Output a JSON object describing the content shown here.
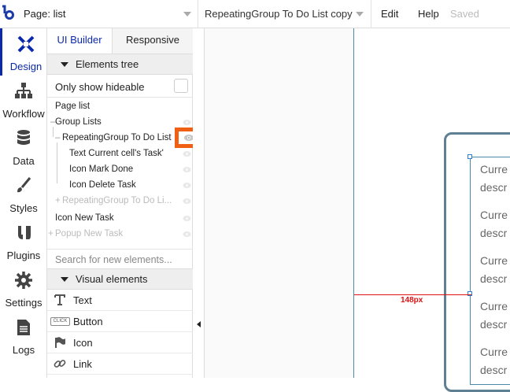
{
  "topbar": {
    "page_label": "Page: list",
    "element_select": "RepeatingGroup To Do List copy",
    "menu_edit": "Edit",
    "menu_help": "Help",
    "status": "Saved"
  },
  "leftnav": {
    "items": [
      {
        "label": "Design",
        "icon": "design-icon"
      },
      {
        "label": "Workflow",
        "icon": "workflow-icon"
      },
      {
        "label": "Data",
        "icon": "database-icon"
      },
      {
        "label": "Styles",
        "icon": "brush-icon"
      },
      {
        "label": "Plugins",
        "icon": "plug-icon"
      },
      {
        "label": "Settings",
        "icon": "gear-icon"
      },
      {
        "label": "Logs",
        "icon": "document-icon"
      }
    ]
  },
  "panel": {
    "tabs": [
      "UI Builder",
      "Responsive"
    ],
    "elements_tree_title": "Elements tree",
    "only_show_hideable": "Only show hideable",
    "tree": [
      "Page list",
      "Group Lists",
      "RepeatingGroup To Do List",
      "Text Current cell's Task'",
      "Icon Mark Done",
      "Icon Delete Task",
      "RepeatingGroup To Do Li...",
      "Icon New Task",
      "Popup New Task"
    ],
    "search_placeholder": "Search for new elements...",
    "visual_elements_title": "Visual elements",
    "visual_elements": [
      "Text",
      "Button",
      "Icon",
      "Link"
    ],
    "button_icon_text": "CLICK"
  },
  "canvas": {
    "measure_label": "148px",
    "cells": [
      [
        "Curre",
        "descr"
      ],
      [
        "Curre",
        "descr"
      ],
      [
        "Curre",
        "descr"
      ],
      [
        "Curre",
        "descr"
      ],
      [
        "Curre",
        "descr"
      ]
    ]
  },
  "colors": {
    "accent": "#0c29ab",
    "highlight": "#f06014",
    "measure": "#dd1111"
  }
}
